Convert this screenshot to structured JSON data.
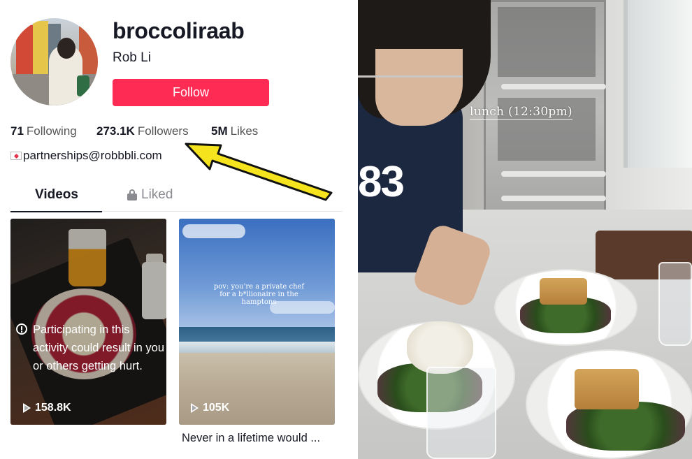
{
  "profile": {
    "username": "broccoliraab",
    "display_name": "Rob Li",
    "follow_label": "Follow",
    "stats": {
      "following_count": "71",
      "following_label": "Following",
      "followers_count": "273.1K",
      "followers_label": "Followers",
      "likes_count": "5M",
      "likes_label": "Likes"
    },
    "bio_email": "partnerships@robbbli.com"
  },
  "tabs": {
    "videos_label": "Videos",
    "liked_label": "Liked"
  },
  "videos": [
    {
      "warning_text": "Participating in this activity could result in you or others getting hurt.",
      "views": "158.8K"
    },
    {
      "overlay_caption": "pov: you're a private chef for a b*llionaire in the hamptons",
      "views": "105K",
      "caption": "Never in a lifetime would ..."
    }
  ],
  "right_photo": {
    "overlay_text": "lunch (12:30pm)",
    "jersey_number": "83"
  },
  "colors": {
    "follow_button": "#fe2c55",
    "arrow": "#f5e31d",
    "text_primary": "#161823",
    "text_secondary": "#555555"
  },
  "icons": [
    "envelope-heart-icon",
    "lock-icon",
    "play-icon",
    "warning-circle-icon",
    "arrow-icon"
  ]
}
